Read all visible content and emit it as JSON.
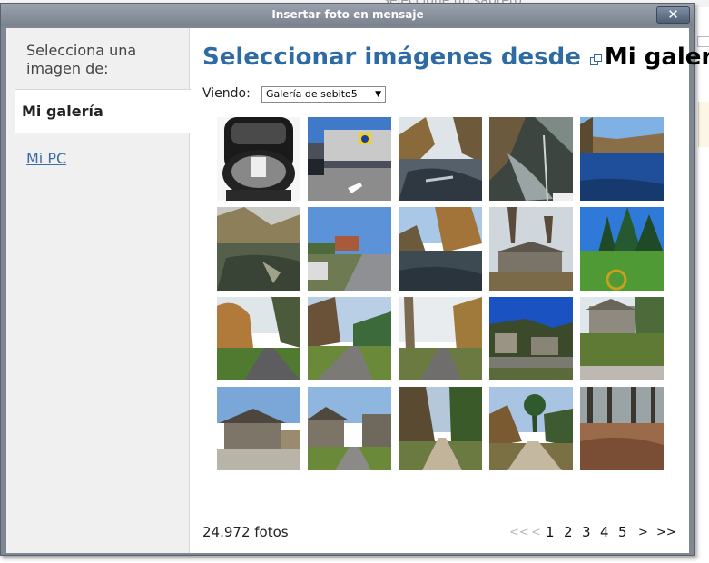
{
  "background": {
    "title": "Seleccione un sabrero"
  },
  "dialog": {
    "title": "Insertar foto en mensaje",
    "close_label": "✕"
  },
  "sidebar": {
    "heading": "Selecciona una imagen de:",
    "items": [
      {
        "label": "Mi galería",
        "active": true
      },
      {
        "label": "Mi PC",
        "active": false
      }
    ]
  },
  "main": {
    "heading_prefix": "Seleccionar imágenes desde",
    "heading_source": "Mi galería",
    "viewing_label": "Viendo:",
    "viewing_value": "Galería de sebito5",
    "photo_count": "24.972 fotos"
  },
  "pagination": {
    "first": "<<",
    "prev": "<",
    "pages": [
      "1",
      "2",
      "3",
      "4",
      "5"
    ],
    "next": ">",
    "last": ">>"
  },
  "thumbnails": [
    {
      "label": "photo-motorcycle-top-case"
    },
    {
      "label": "photo-lidl-store"
    },
    {
      "label": "photo-flooded-river-trees"
    },
    {
      "label": "photo-flooded-river-shadows"
    },
    {
      "label": "photo-river-blue-sky"
    },
    {
      "label": "photo-flooded-meadow"
    },
    {
      "label": "photo-village-road"
    },
    {
      "label": "photo-flooded-forest"
    },
    {
      "label": "photo-stone-shed"
    },
    {
      "label": "photo-green-field-pines"
    },
    {
      "label": "photo-country-lane-autumn"
    },
    {
      "label": "photo-lane-bare-trees"
    },
    {
      "label": "photo-lane-poplars"
    },
    {
      "label": "photo-stone-houses-blue-sky"
    },
    {
      "label": "photo-old-stone-house"
    },
    {
      "label": "photo-barn-stone"
    },
    {
      "label": "photo-stone-houses-road"
    },
    {
      "label": "photo-dirt-road-forest"
    },
    {
      "label": "photo-dirt-road-shrubs"
    },
    {
      "label": "photo-pine-forest-ferns"
    }
  ]
}
